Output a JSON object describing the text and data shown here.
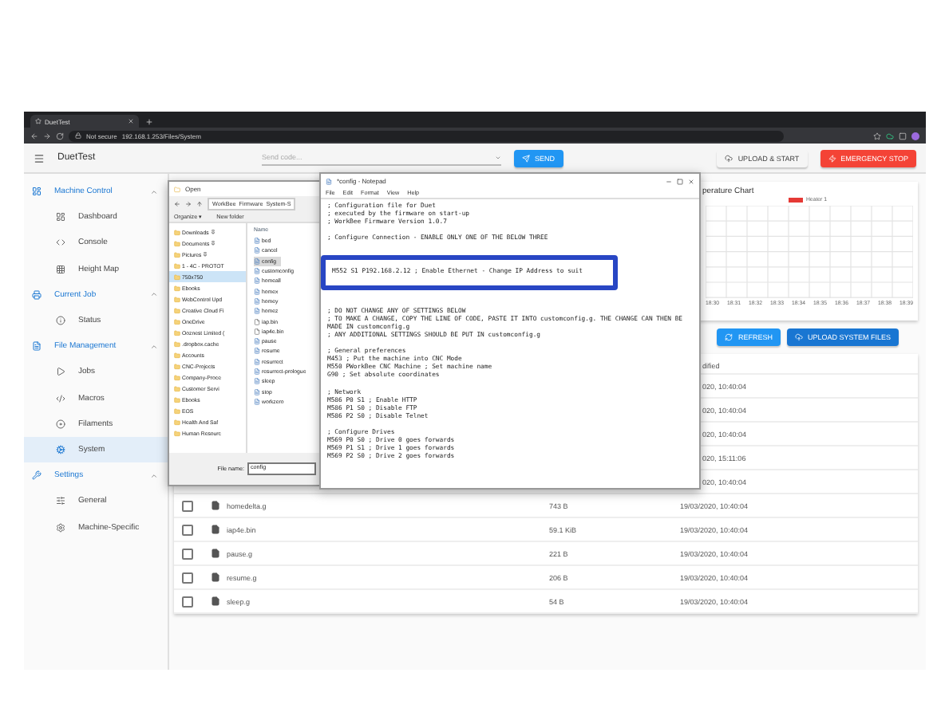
{
  "browser": {
    "tab_title": "DuetTest",
    "address_warning": "Not secure",
    "url": "192.168.1.253/Files/System"
  },
  "app_bar": {
    "title": "DuetTest",
    "send_placeholder": "Send code...",
    "send_button": "SEND",
    "upload_button": "UPLOAD & START",
    "stop_button": "EMERGENCY STOP"
  },
  "sidebar": [
    {
      "label": "Machine Control",
      "expanded": true,
      "children": [
        {
          "label": "Dashboard",
          "selected": false
        },
        {
          "label": "Console",
          "selected": false
        },
        {
          "label": "Height Map",
          "selected": false
        }
      ]
    },
    {
      "label": "Current Job",
      "expanded": true,
      "children": [
        {
          "label": "Status",
          "selected": false
        }
      ]
    },
    {
      "label": "File Management",
      "expanded": true,
      "children": [
        {
          "label": "Jobs",
          "selected": false
        },
        {
          "label": "Macros",
          "selected": false
        },
        {
          "label": "Filaments",
          "selected": false
        },
        {
          "label": "System",
          "selected": true
        }
      ]
    },
    {
      "label": "Settings",
      "expanded": true,
      "children": [
        {
          "label": "General",
          "selected": false
        },
        {
          "label": "Machine-Specific",
          "selected": false
        }
      ]
    }
  ],
  "chart": {
    "title": "perature Chart",
    "legend": [
      {
        "label": "Heater 1",
        "color": "#e53935"
      }
    ],
    "x_labels": [
      "18:30",
      "18:31",
      "18:32",
      "18:33",
      "18:34",
      "18:35",
      "18:36",
      "18:37",
      "18:38",
      "18:39"
    ]
  },
  "toolbar": {
    "refresh_button": "REFRESH",
    "upload_button": "UPLOAD SYSTEM FILES"
  },
  "table": {
    "header_date": "dified",
    "rows": [
      {
        "kind": "partial",
        "date": "020, 10:40:04"
      },
      {
        "kind": "partial",
        "date": "020, 10:40:04"
      },
      {
        "kind": "partial",
        "date": "020, 10:40:04"
      },
      {
        "kind": "partial",
        "date": "020, 15:11:06"
      },
      {
        "kind": "partial",
        "date": "020, 10:40:04"
      },
      {
        "kind": "file",
        "checked": false,
        "name": "homedelta.g",
        "size": "743 B",
        "date": "19/03/2020, 10:40:04"
      },
      {
        "kind": "file",
        "checked": false,
        "name": "iap4e.bin",
        "size": "59.1 KiB",
        "date": "19/03/2020, 10:40:04"
      },
      {
        "kind": "file",
        "checked": false,
        "name": "pause.g",
        "size": "221 B",
        "date": "19/03/2020, 10:40:04"
      },
      {
        "kind": "file",
        "checked": false,
        "name": "resume.g",
        "size": "206 B",
        "date": "19/03/2020, 10:40:04"
      },
      {
        "kind": "file",
        "checked": false,
        "name": "sleep.g",
        "size": "54 B",
        "date": "19/03/2020, 10:40:04"
      }
    ]
  },
  "file_dialog": {
    "title": "Open",
    "path": [
      "WorkBee",
      "Firmware",
      "System-S"
    ],
    "organize": "Organize ▾",
    "new_folder": "New folder",
    "column_name": "Name",
    "nav": [
      {
        "label": "Downloads",
        "pinned": true,
        "selected": false
      },
      {
        "label": "Documents",
        "pinned": true,
        "selected": false
      },
      {
        "label": "Pictures",
        "pinned": true,
        "selected": false
      },
      {
        "label": "1 - 4C - PROTOT",
        "pinned": false,
        "selected": false
      },
      {
        "label": "750x750",
        "pinned": false,
        "selected": true
      },
      {
        "label": "Ebooks",
        "pinned": false,
        "selected": false
      },
      {
        "label": "WebControl Upd",
        "pinned": false,
        "selected": false
      },
      {
        "label": "Creative Cloud Fi",
        "pinned": false,
        "selected": false
      },
      {
        "label": "OneDrive",
        "pinned": false,
        "selected": false
      },
      {
        "label": "Ooznest Limited (",
        "pinned": false,
        "selected": false
      },
      {
        "label": ".dropbox.cache",
        "pinned": false,
        "selected": false
      },
      {
        "label": "Accounts",
        "pinned": false,
        "selected": false
      },
      {
        "label": "CNC-Projects",
        "pinned": false,
        "selected": false
      },
      {
        "label": "Company-Proce",
        "pinned": false,
        "selected": false
      },
      {
        "label": "Customer Servi",
        "pinned": false,
        "selected": false
      },
      {
        "label": "Ebooks",
        "pinned": false,
        "selected": false
      },
      {
        "label": "EOS",
        "pinned": false,
        "selected": false
      },
      {
        "label": "Health And Saf",
        "pinned": false,
        "selected": false
      },
      {
        "label": "Human Resourc",
        "pinned": false,
        "selected": false
      }
    ],
    "files": [
      {
        "name": "bed",
        "kind": "text",
        "selected": false
      },
      {
        "name": "cancel",
        "kind": "text",
        "selected": false
      },
      {
        "name": "config",
        "kind": "text",
        "selected": true
      },
      {
        "name": "customconfig",
        "kind": "text",
        "selected": false
      },
      {
        "name": "homeall",
        "kind": "text",
        "selected": false
      },
      {
        "name": "homex",
        "kind": "text",
        "selected": false
      },
      {
        "name": "homey",
        "kind": "text",
        "selected": false
      },
      {
        "name": "homez",
        "kind": "text",
        "selected": false
      },
      {
        "name": "iap.bin",
        "kind": "binary",
        "selected": false
      },
      {
        "name": "iap4e.bin",
        "kind": "binary",
        "selected": false
      },
      {
        "name": "pause",
        "kind": "text",
        "selected": false
      },
      {
        "name": "resume",
        "kind": "text",
        "selected": false
      },
      {
        "name": "resurrect",
        "kind": "text",
        "selected": false
      },
      {
        "name": "resurrect-prologue",
        "kind": "text",
        "selected": false
      },
      {
        "name": "sleep",
        "kind": "text",
        "selected": false
      },
      {
        "name": "stop",
        "kind": "text",
        "selected": false
      },
      {
        "name": "workzero",
        "kind": "text",
        "selected": false
      }
    ],
    "file_name_label": "File name:",
    "file_name_value": "config"
  },
  "notepad": {
    "title": "*config - Notepad",
    "menu": [
      "File",
      "Edit",
      "Format",
      "View",
      "Help"
    ],
    "blocks": [
      {
        "kind": "plain",
        "lines": [
          "; Configuration file for Duet",
          "; executed by the firmware on start-up",
          "; WorkBee Firmware Version 1.0.7"
        ]
      },
      {
        "kind": "plain",
        "lines": [
          "; Configure Connection - ENABLE ONLY ONE OF THE BELOW THREE"
        ]
      },
      {
        "kind": "highlight",
        "lines": [
          "M552 S1 P192.168.2.12 ; Enable Ethernet - Change IP Address to suit"
        ]
      },
      {
        "kind": "plain",
        "lines": [
          "; DO NOT CHANGE ANY OF SETTINGS BELOW",
          "; TO MAKE A CHANGE, COPY THE LINE OF CODE, PASTE IT INTO customconfig.g. THE CHANGE CAN THEN BE",
          "MADE IN customconfig.g",
          "; ANY ADDITIONAL SETTINGS SHOULD BE PUT IN customconfig.g"
        ]
      },
      {
        "kind": "plain",
        "lines": [
          "; General preferences",
          "M453 ; Put the machine into CNC Mode",
          "M550 PWorkBee CNC Machine ; Set machine name",
          "G90 ; Set absolute coordinates"
        ]
      },
      {
        "kind": "plain",
        "lines": [
          "; Network",
          "M586 P0 S1 ; Enable HTTP",
          "M586 P1 S0 ; Disable FTP",
          "M586 P2 S0 ; Disable Telnet"
        ]
      },
      {
        "kind": "plain",
        "lines": [
          "; Configure Drives",
          "M569 P0 S0 ; Drive 0 goes forwards",
          "M569 P1 S1 ; Drive 1 goes forwards",
          "M569 P2 S0 ; Drive 2 goes forwards"
        ]
      }
    ]
  }
}
